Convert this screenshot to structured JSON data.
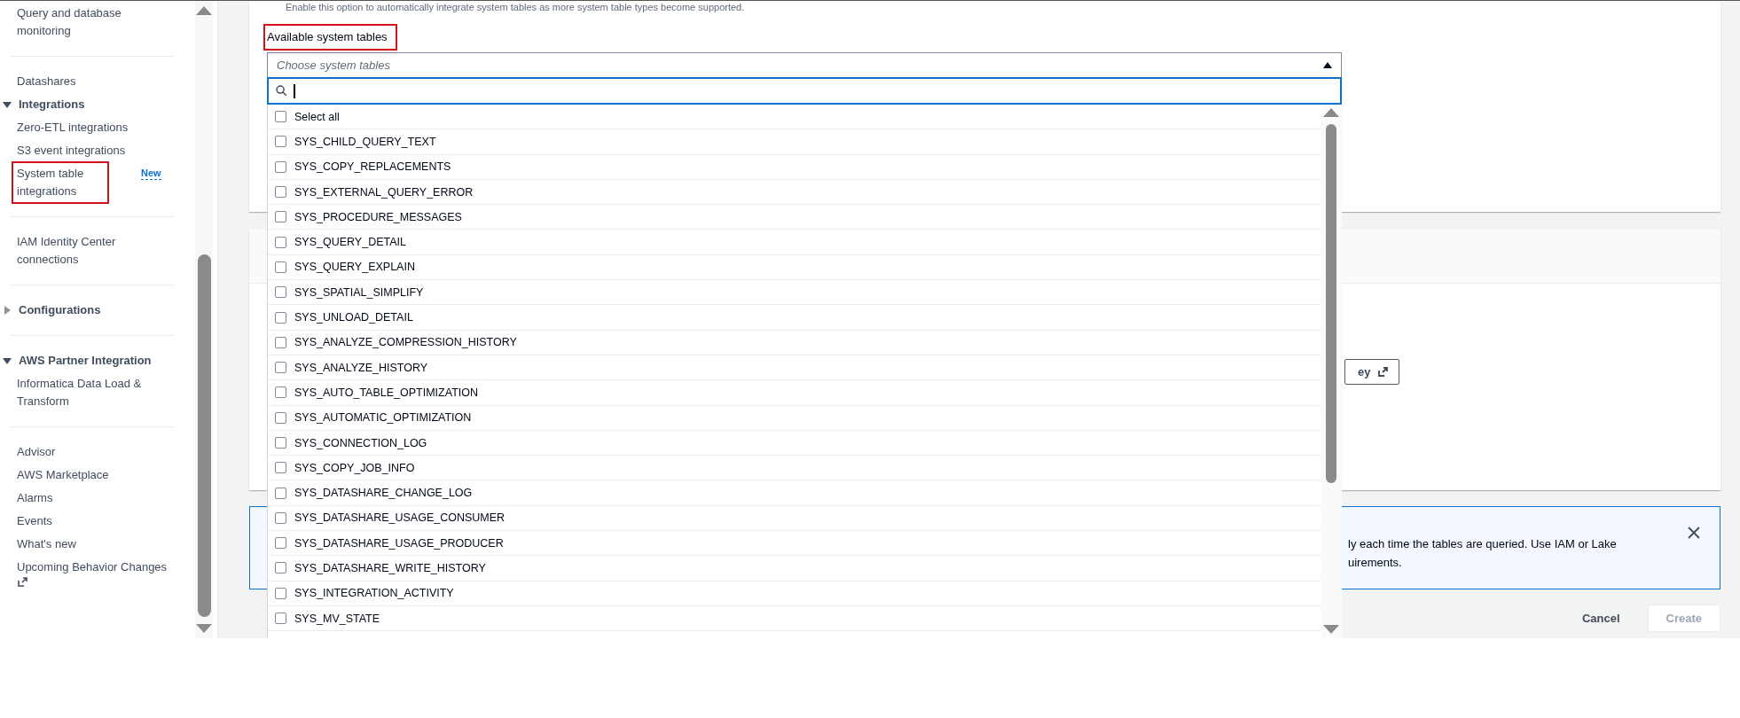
{
  "sidebar": {
    "items": [
      {
        "kind": "link",
        "label": "Query and database monitoring"
      },
      {
        "kind": "divider"
      },
      {
        "kind": "link",
        "label": "Datashares"
      },
      {
        "kind": "section",
        "label": "Integrations",
        "expanded": true
      },
      {
        "kind": "link",
        "label": "Zero-ETL integrations"
      },
      {
        "kind": "link",
        "label": "S3 event integrations"
      },
      {
        "kind": "link",
        "label": "System table integrations",
        "badge": "New",
        "highlighted": true
      },
      {
        "kind": "divider"
      },
      {
        "kind": "link",
        "label": "IAM Identity Center connections"
      },
      {
        "kind": "divider"
      },
      {
        "kind": "section",
        "label": "Configurations",
        "expanded": false
      },
      {
        "kind": "divider"
      },
      {
        "kind": "section",
        "label": "AWS Partner Integration",
        "expanded": true
      },
      {
        "kind": "link",
        "label": "Informatica Data Load & Transform"
      },
      {
        "kind": "divider"
      },
      {
        "kind": "link",
        "label": "Advisor"
      },
      {
        "kind": "link",
        "label": "AWS Marketplace"
      },
      {
        "kind": "link",
        "label": "Alarms"
      },
      {
        "kind": "link",
        "label": "Events"
      },
      {
        "kind": "link",
        "label": "What's new"
      },
      {
        "kind": "link",
        "label": "Upcoming Behavior Changes",
        "external": true
      }
    ]
  },
  "form": {
    "description": "Enable this option to automatically integrate system tables as more system table types become supported.",
    "field": {
      "label": "Available system tables",
      "highlighted": true,
      "placeholder": "Choose system tables",
      "expanded": true
    },
    "options": [
      {
        "label": "Select all",
        "checked": false
      },
      {
        "label": "SYS_CHILD_QUERY_TEXT",
        "checked": false
      },
      {
        "label": "SYS_COPY_REPLACEMENTS",
        "checked": false
      },
      {
        "label": "SYS_EXTERNAL_QUERY_ERROR",
        "checked": false
      },
      {
        "label": "SYS_PROCEDURE_MESSAGES",
        "checked": false
      },
      {
        "label": "SYS_QUERY_DETAIL",
        "checked": false
      },
      {
        "label": "SYS_QUERY_EXPLAIN",
        "checked": false
      },
      {
        "label": "SYS_SPATIAL_SIMPLIFY",
        "checked": false
      },
      {
        "label": "SYS_UNLOAD_DETAIL",
        "checked": false
      },
      {
        "label": "SYS_ANALYZE_COMPRESSION_HISTORY",
        "checked": false
      },
      {
        "label": "SYS_ANALYZE_HISTORY",
        "checked": false
      },
      {
        "label": "SYS_AUTO_TABLE_OPTIMIZATION",
        "checked": false
      },
      {
        "label": "SYS_AUTOMATIC_OPTIMIZATION",
        "checked": false
      },
      {
        "label": "SYS_CONNECTION_LOG",
        "checked": false
      },
      {
        "label": "SYS_COPY_JOB_INFO",
        "checked": false
      },
      {
        "label": "SYS_DATASHARE_CHANGE_LOG",
        "checked": false
      },
      {
        "label": "SYS_DATASHARE_USAGE_CONSUMER",
        "checked": false
      },
      {
        "label": "SYS_DATASHARE_USAGE_PRODUCER",
        "checked": false
      },
      {
        "label": "SYS_DATASHARE_WRITE_HISTORY",
        "checked": false
      },
      {
        "label": "SYS_INTEGRATION_ACTIVITY",
        "checked": false
      },
      {
        "label": "SYS_MV_STATE",
        "checked": false
      }
    ],
    "key_button": {
      "label": "ey"
    },
    "info": {
      "lines": [
        "ly each time the tables are queried. Use IAM or Lake",
        "uirements."
      ]
    },
    "actions": [
      {
        "kind": "link",
        "label": "Cancel",
        "disabled": false
      },
      {
        "kind": "primary",
        "label": "Create",
        "disabled": true
      }
    ]
  }
}
